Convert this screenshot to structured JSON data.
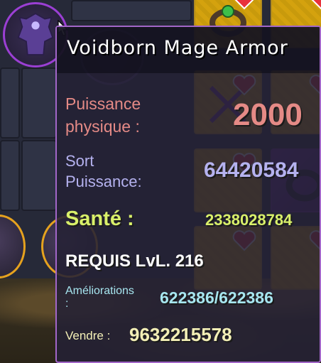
{
  "item": {
    "name": "Voidborn Mage Armor"
  },
  "stats": {
    "physical_power_label_line1": "Puissance",
    "physical_power_label_line2": "physique :",
    "physical_power_value": "2000",
    "spell_power_label_line1": "Sort",
    "spell_power_label_line2": "Puissance:",
    "spell_power_value": "64420584",
    "health_label": "Santé :",
    "health_value": "2338028784",
    "requirement": "REQUIS LvL. 216",
    "upgrades_label_line1": "Améliorations",
    "upgrades_label_line2": ":",
    "upgrades_value": "622386/622386",
    "sell_label": "Vendre :",
    "sell_value": "9632215578"
  },
  "colors": {
    "physical": "#e58a86",
    "spell": "#b5b2ef",
    "health": "#d9f06a",
    "upgrades": "#a7e6f0",
    "sell": "#f3efb6",
    "tooltip_border": "#a266c8"
  },
  "icons": {
    "avatar": "armor-portrait-icon",
    "heart": "heart-icon",
    "cursor": "mouse-cursor-icon"
  }
}
